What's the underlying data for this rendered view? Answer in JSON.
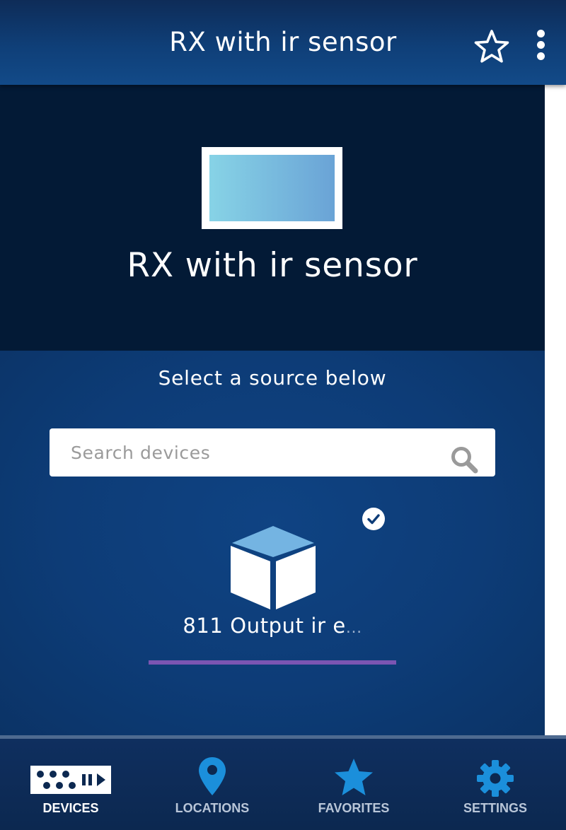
{
  "header": {
    "title": "RX with ir sensor"
  },
  "hero": {
    "device_name": "RX with ir sensor"
  },
  "content": {
    "select_label": "Select a source below",
    "search": {
      "placeholder": "Search devices",
      "value": ""
    },
    "devices": [
      {
        "label": "811 Output ir e",
        "truncation": "...",
        "selected": true,
        "icon": "box-icon"
      }
    ]
  },
  "bottom_nav": {
    "active": "DEVICES",
    "items": [
      {
        "label": "DEVICES",
        "icon": "devices-icon"
      },
      {
        "label": "LOCATIONS",
        "icon": "location-pin-icon"
      },
      {
        "label": "FAVORITES",
        "icon": "star-icon"
      },
      {
        "label": "SETTINGS",
        "icon": "gear-icon"
      }
    ]
  },
  "colors": {
    "header_bg": "#0f3f78",
    "hero_bg": "#031a36",
    "content_bg": "#0d3c77",
    "accent_underline": "#7b55b2",
    "nav_icon_blue": "#1b8fdb"
  }
}
